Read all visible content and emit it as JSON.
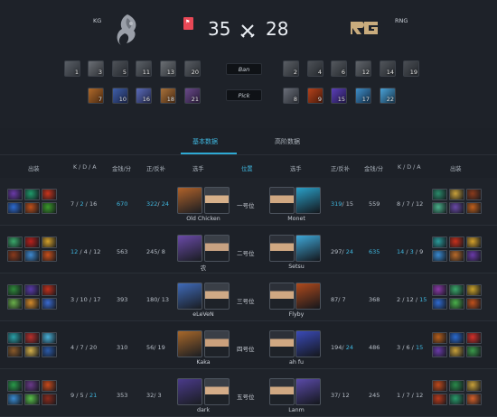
{
  "teams": {
    "left": {
      "name": "KG",
      "score": "35"
    },
    "right": {
      "name": "RNG",
      "score": "28"
    }
  },
  "draft": {
    "ban_label": "Ban",
    "pick_label": "Pick",
    "left_bans": [
      "1",
      "3",
      "5",
      "11",
      "13",
      "20"
    ],
    "right_bans": [
      "2",
      "4",
      "6",
      "12",
      "14",
      "19"
    ],
    "left_picks": [
      "7",
      "10",
      "16",
      "18",
      "21"
    ],
    "right_picks": [
      "8",
      "9",
      "15",
      "17",
      "22"
    ]
  },
  "tabs": [
    {
      "label": "基本数据",
      "active": true
    },
    {
      "label": "高阶数据",
      "active": false
    }
  ],
  "columns": {
    "items_left": "出装",
    "kda_left": "K / D / A",
    "gpm_left": "金钱/分",
    "lh_left": "正/反补",
    "player_left": "选手",
    "position": "位置",
    "player_right": "选手",
    "lh_right": "正/反补",
    "gpm_right": "金钱/分",
    "kda_right": "K / D / A",
    "items_right": "出装"
  },
  "rows": [
    {
      "position": "一号位",
      "left": {
        "player": "Old Chicken",
        "k": "7",
        "d": "2",
        "a": "16",
        "gpm": "670",
        "lh": "322",
        "dn": "24"
      },
      "right": {
        "player": "Monet",
        "k": "8",
        "d": "7",
        "a": "12",
        "gpm": "559",
        "lh": "319",
        "dn": "15"
      }
    },
    {
      "position": "二号位",
      "left": {
        "player": "农",
        "k": "12",
        "d": "4",
        "a": "12",
        "gpm": "563",
        "lh": "245",
        "dn": "8"
      },
      "right": {
        "player": "Setsu",
        "k": "14",
        "d": "3",
        "a": "9",
        "gpm": "635",
        "lh": "297",
        "dn": "24"
      }
    },
    {
      "position": "三号位",
      "left": {
        "player": "eLeVeN",
        "k": "3",
        "d": "10",
        "a": "17",
        "gpm": "393",
        "lh": "180",
        "dn": "13"
      },
      "right": {
        "player": "Flyby",
        "k": "2",
        "d": "12",
        "a": "15",
        "gpm": "368",
        "lh": "87",
        "dn": "7"
      }
    },
    {
      "position": "四号位",
      "left": {
        "player": "Kaka",
        "k": "4",
        "d": "7",
        "a": "20",
        "gpm": "310",
        "lh": "56",
        "dn": "19"
      },
      "right": {
        "player": "ah fu",
        "k": "3",
        "d": "6",
        "a": "15",
        "gpm": "486",
        "lh": "194",
        "dn": "24"
      }
    },
    {
      "position": "五号位",
      "left": {
        "player": "dark",
        "k": "9",
        "d": "5",
        "a": "21",
        "gpm": "353",
        "lh": "32",
        "dn": "3"
      },
      "right": {
        "player": "Lanm",
        "k": "1",
        "d": "7",
        "a": "12",
        "gpm": "245",
        "lh": "37",
        "dn": "12"
      }
    }
  ],
  "colors": {
    "accent": "#3fb7df",
    "background": "#1d2128",
    "red_badge": "#e84856"
  }
}
